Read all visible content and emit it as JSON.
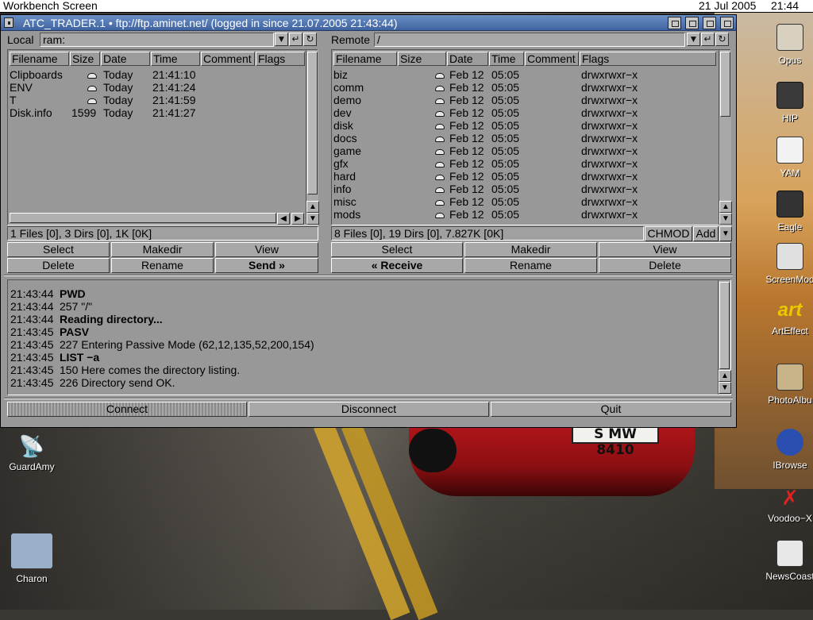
{
  "workbench": {
    "title": "Workbench Screen",
    "date": "21 Jul 2005",
    "time": "21:44"
  },
  "window": {
    "title": "ATC_TRADER.1 • ftp://ftp.aminet.net/ (logged in since 21.07.2005 21:43:44)"
  },
  "local": {
    "label": "Local",
    "path": "ram:",
    "headers": [
      "Filename",
      "Size",
      "Date",
      "Time",
      "Comment",
      "Flags"
    ],
    "rows": [
      {
        "name": "Clipboards",
        "size": "",
        "dir": true,
        "date": "Today",
        "time": "21:41:10"
      },
      {
        "name": "ENV",
        "size": "",
        "dir": true,
        "date": "Today",
        "time": "21:41:24"
      },
      {
        "name": "T",
        "size": "",
        "dir": true,
        "date": "Today",
        "time": "21:41:59"
      },
      {
        "name": "Disk.info",
        "size": "1599",
        "dir": false,
        "date": "Today",
        "time": "21:41:27"
      }
    ],
    "status": "1 Files [0], 3 Dirs [0], 1K [0K]",
    "buttons": {
      "select": "Select",
      "makedir": "Makedir",
      "view": "View",
      "delete": "Delete",
      "rename": "Rename",
      "send": "Send »"
    }
  },
  "remote": {
    "label": "Remote",
    "path": "/",
    "headers": [
      "Filename",
      "Size",
      "Date",
      "Time",
      "Comment",
      "Flags"
    ],
    "rows": [
      {
        "name": "biz",
        "date": "Feb 12",
        "time": "05:05",
        "flags": "drwxrwxr−x"
      },
      {
        "name": "comm",
        "date": "Feb 12",
        "time": "05:05",
        "flags": "drwxrwxr−x"
      },
      {
        "name": "demo",
        "date": "Feb 12",
        "time": "05:05",
        "flags": "drwxrwxr−x"
      },
      {
        "name": "dev",
        "date": "Feb 12",
        "time": "05:05",
        "flags": "drwxrwxr−x"
      },
      {
        "name": "disk",
        "date": "Feb 12",
        "time": "05:05",
        "flags": "drwxrwxr−x"
      },
      {
        "name": "docs",
        "date": "Feb 12",
        "time": "05:05",
        "flags": "drwxrwxr−x"
      },
      {
        "name": "game",
        "date": "Feb 12",
        "time": "05:05",
        "flags": "drwxrwxr−x"
      },
      {
        "name": "gfx",
        "date": "Feb 12",
        "time": "05:05",
        "flags": "drwxrwxr−x"
      },
      {
        "name": "hard",
        "date": "Feb 12",
        "time": "05:05",
        "flags": "drwxrwxr−x"
      },
      {
        "name": "info",
        "date": "Feb 12",
        "time": "05:05",
        "flags": "drwxrwxr−x"
      },
      {
        "name": "misc",
        "date": "Feb 12",
        "time": "05:05",
        "flags": "drwxrwxr−x"
      },
      {
        "name": "mods",
        "date": "Feb 12",
        "time": "05:05",
        "flags": "drwxrwxr−x"
      }
    ],
    "status": "8 Files [0], 19 Dirs [0], 7.827K [0K]",
    "chmod": "CHMOD",
    "add": "Add",
    "buttons": {
      "select": "Select",
      "makedir": "Makedir",
      "view": "View",
      "receive": "« Receive",
      "rename": "Rename",
      "delete": "Delete"
    }
  },
  "log": [
    {
      "time": "21:43:44",
      "msg": "PWD",
      "bold": true
    },
    {
      "time": "21:43:44",
      "msg": "257 \"/\"",
      "bold": false
    },
    {
      "time": "21:43:44",
      "msg": "Reading directory...",
      "bold": true
    },
    {
      "time": "21:43:45",
      "msg": "PASV",
      "bold": true
    },
    {
      "time": "21:43:45",
      "msg": "227 Entering Passive Mode (62,12,135,52,200,154)",
      "bold": false
    },
    {
      "time": "21:43:45",
      "msg": "LIST −a",
      "bold": true
    },
    {
      "time": "21:43:45",
      "msg": "150 Here comes the directory listing.",
      "bold": false
    },
    {
      "time": "21:43:45",
      "msg": "226 Directory send OK.",
      "bold": false
    }
  ],
  "bottom": {
    "connect": "Connect",
    "disconnect": "Disconnect",
    "quit": "Quit"
  },
  "desktop_icons": {
    "opus": "Opus",
    "hip": "HIP",
    "yam": "YAM",
    "eagle": "Eagle",
    "screenmode": "ScreenMod",
    "arteffect": "ArtEffect",
    "photoalbum": "PhotoAlbu",
    "ibrowse": "IBrowse",
    "voodoo": "Voodoo−X",
    "newscoaster": "NewsCoast",
    "guardamy": "GuardAmy",
    "charon": "Charon"
  },
  "plate_text": "S MW 8410"
}
